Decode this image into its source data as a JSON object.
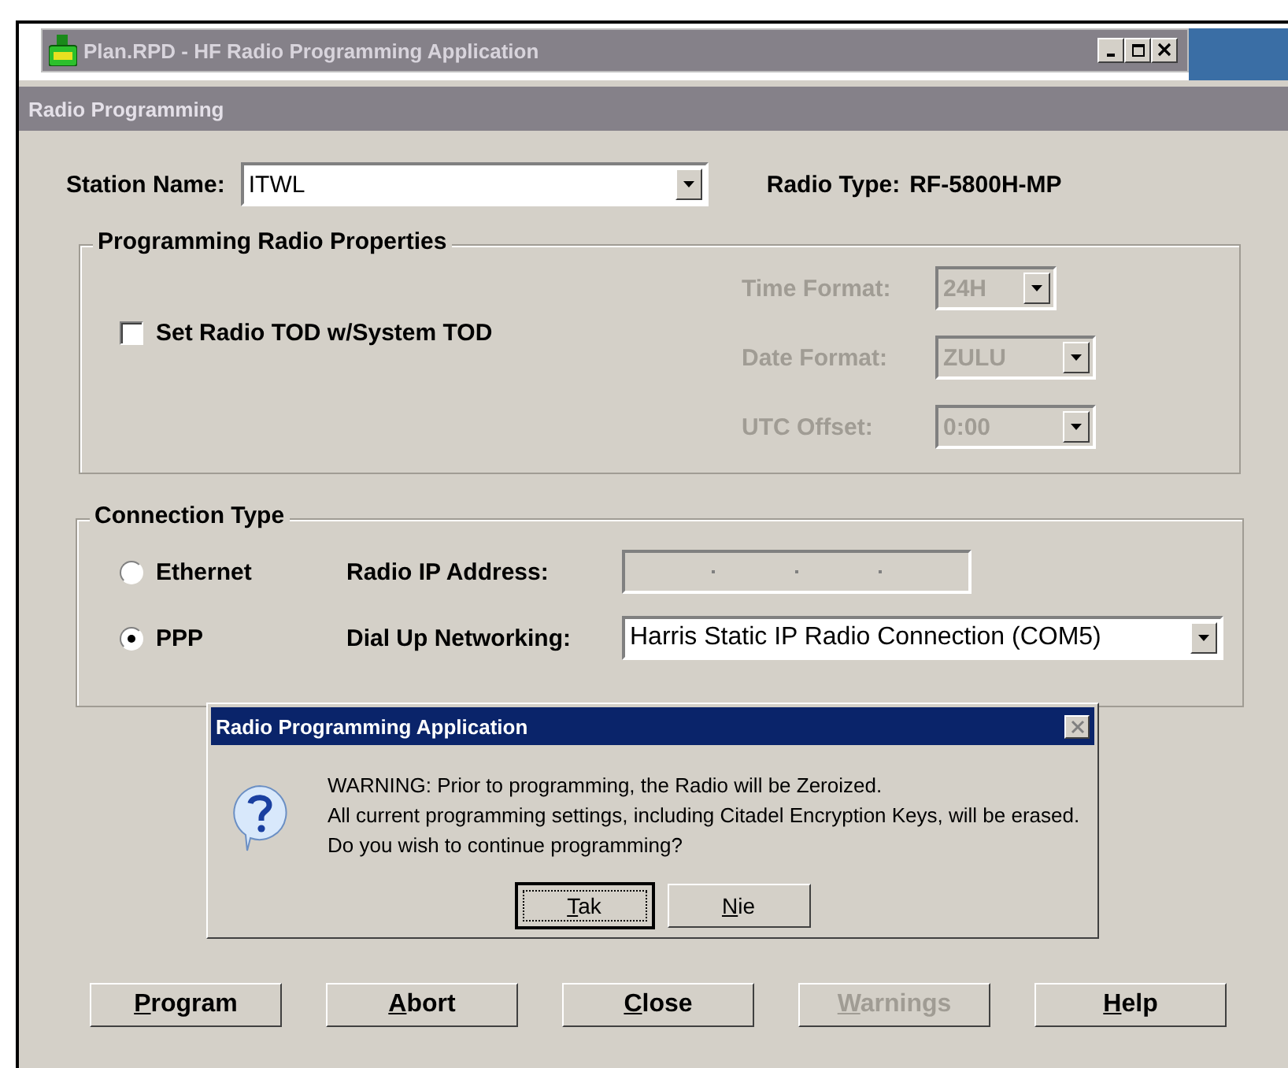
{
  "window": {
    "title": "Plan.RPD - HF Radio Programming Application"
  },
  "panel_title": "Radio Programming",
  "station": {
    "label": "Station Name:",
    "value": "ITWL"
  },
  "radio_type": {
    "label": "Radio Type:",
    "value": "RF-5800H-MP"
  },
  "properties": {
    "title": "Programming Radio Properties",
    "checkbox": {
      "label": "Set Radio TOD w/System TOD",
      "checked": false
    },
    "fields": [
      {
        "label": "Time Format:",
        "value": "24H",
        "disabled": true
      },
      {
        "label": "Date Format:",
        "value": "ZULU",
        "disabled": true
      },
      {
        "label": "UTC Offset:",
        "value": "0:00",
        "disabled": true
      }
    ]
  },
  "connection": {
    "title": "Connection Type",
    "options": [
      {
        "label": "Ethernet",
        "selected": false,
        "field_label": "Radio IP Address:",
        "kind": "ip",
        "disabled": true
      },
      {
        "label": "PPP",
        "selected": true,
        "field_label": "Dial Up Networking:",
        "kind": "combo",
        "value": "Harris Static IP Radio Connection (COM5)",
        "disabled": false
      }
    ]
  },
  "buttons": [
    {
      "mnemonic": "P",
      "rest": "rogram",
      "disabled": false
    },
    {
      "mnemonic": "A",
      "rest": "bort",
      "disabled": false
    },
    {
      "mnemonic": "C",
      "rest": "lose",
      "disabled": false
    },
    {
      "mnemonic": "W",
      "rest": "arnings",
      "disabled": true
    },
    {
      "mnemonic": "H",
      "rest": "elp",
      "disabled": false
    }
  ],
  "dialog": {
    "title": "Radio Programming Application",
    "lines": [
      "WARNING: Prior to programming, the Radio will be Zeroized.",
      "All current programming settings, including Citadel Encryption Keys, will be erased.",
      "Do you wish to continue programming?"
    ],
    "buttons": [
      {
        "mnemonic": "T",
        "rest": "ak",
        "focused": true
      },
      {
        "mnemonic": "N",
        "rest": "ie",
        "focused": false
      }
    ]
  }
}
